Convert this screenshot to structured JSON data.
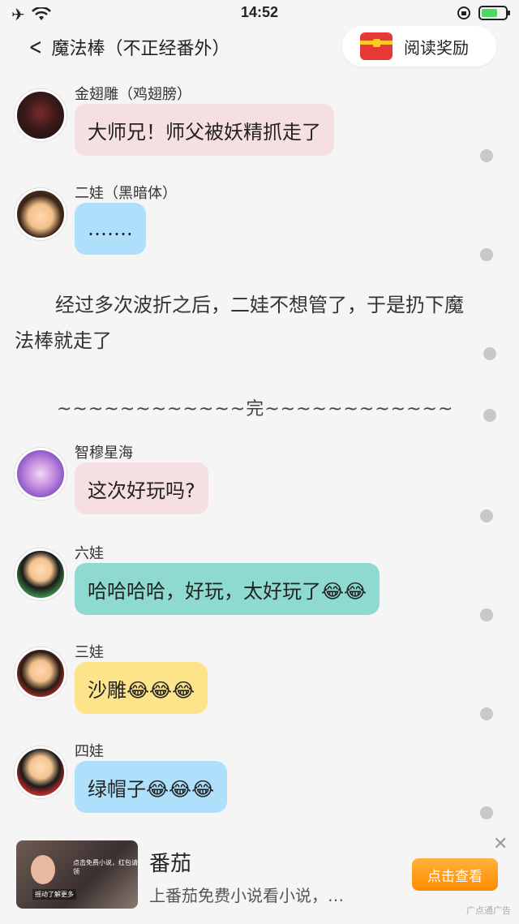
{
  "status": {
    "time": "14:52"
  },
  "nav": {
    "title": "魔法棒（不正经番外）",
    "reward_label": "阅读奖励"
  },
  "messages": [
    {
      "name": "金翅雕（鸡翅膀）",
      "text": "大师兄！师父被妖精抓走了"
    },
    {
      "name": "二娃（黑暗体）",
      "text": "……."
    },
    {
      "name": "智穆星海",
      "text": "这次好玩吗?"
    },
    {
      "name": "六娃",
      "text": "哈哈哈哈，好玩，太好玩了😂😂"
    },
    {
      "name": "三娃",
      "text": "沙雕😂😂😂"
    },
    {
      "name": "四娃",
      "text": "绿帽子😂😂😂"
    }
  ],
  "narration": "经过多次波折之后，二娃不想管了，于是扔下魔法棒就走了",
  "divider": "~~~~~~~~~~~~完~~~~~~~~~~~~",
  "ad": {
    "title": "番茄",
    "description": "上番茄免费小说看小说，…",
    "button_label": "点击查看",
    "brand": "广点通广告",
    "thumb_text_1": "点击免费小说，红包请领",
    "thumb_text_2": "摇动了解更多"
  },
  "colors": {
    "pink_bubble": "#f5dfe1",
    "blue_bubble": "#aee0fb",
    "teal_bubble": "#8fdad0",
    "yellow_bubble": "#fde38a",
    "ad_button": "#ff9a1a"
  }
}
